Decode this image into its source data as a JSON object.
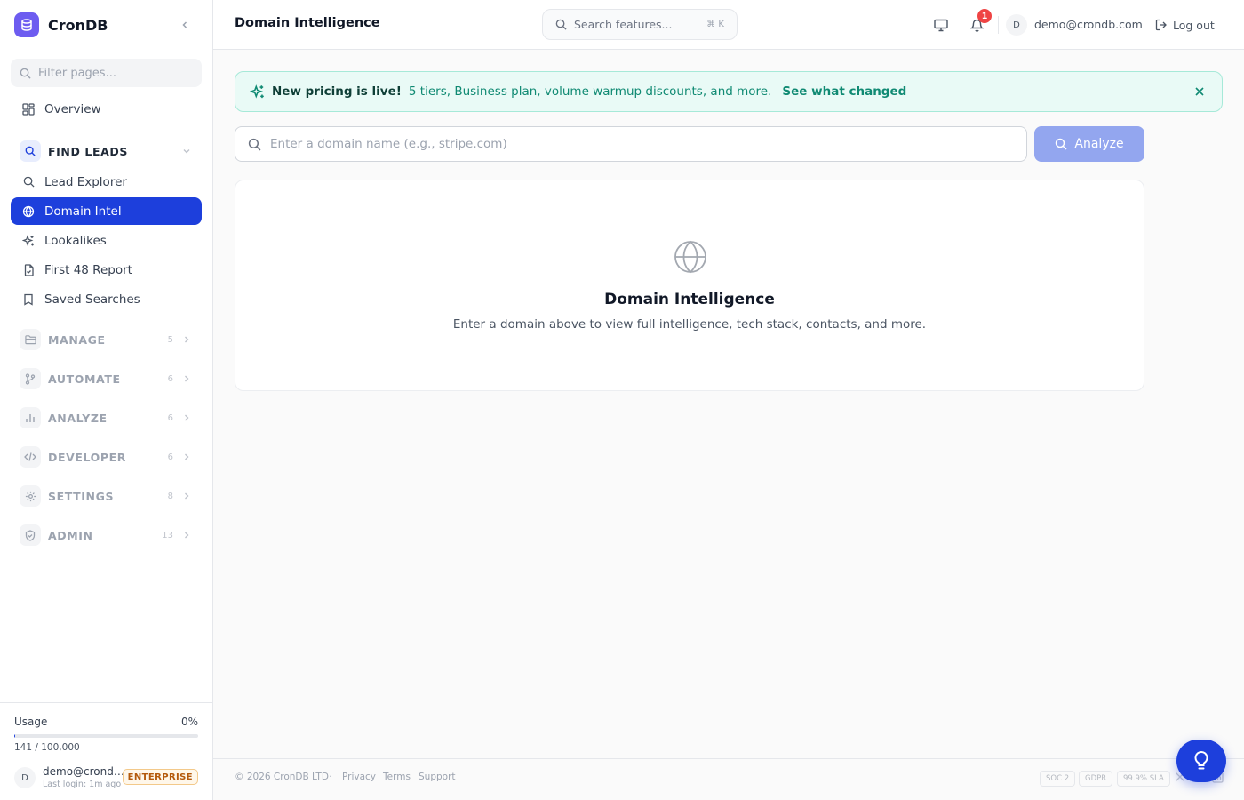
{
  "app": {
    "name": "CronDB"
  },
  "sidebar": {
    "filter_placeholder": "Filter pages...",
    "overview_label": "Overview",
    "find_leads": {
      "label": "FIND LEADS",
      "items": [
        {
          "label": "Lead Explorer",
          "icon": "search-icon"
        },
        {
          "label": "Domain Intel",
          "icon": "globe-icon",
          "active": true
        },
        {
          "label": "Lookalikes",
          "icon": "sparkle-icon"
        },
        {
          "label": "First 48 Report",
          "icon": "file-icon"
        },
        {
          "label": "Saved Searches",
          "icon": "bookmark-icon"
        }
      ]
    },
    "sections": [
      {
        "label": "MANAGE",
        "count": "5",
        "icon": "folder-icon"
      },
      {
        "label": "AUTOMATE",
        "count": "6",
        "icon": "branch-icon"
      },
      {
        "label": "ANALYZE",
        "count": "6",
        "icon": "bar-chart-icon"
      },
      {
        "label": "DEVELOPER",
        "count": "6",
        "icon": "code-icon"
      },
      {
        "label": "SETTINGS",
        "count": "8",
        "icon": "gear-icon"
      },
      {
        "label": "ADMIN",
        "count": "13",
        "icon": "shield-icon"
      }
    ],
    "usage": {
      "label": "Usage",
      "percent_text": "0%",
      "fraction": 0.0014,
      "count_text": "141 / 100,000"
    },
    "user": {
      "initial": "D",
      "email": "demo@crondb.com",
      "last_login": "Last login: 1m ago",
      "plan": "ENTERPRISE"
    }
  },
  "header": {
    "title": "Domain Intelligence",
    "search_placeholder": "Search features...",
    "search_shortcut": "⌘ K",
    "notification_count": "1",
    "user_initial": "D",
    "user_email": "demo@crondb.com",
    "logout_label": "Log out"
  },
  "banner": {
    "title": "New pricing is live!",
    "text": "5 tiers, Business plan, volume warmup discounts, and more.",
    "link": "See what changed"
  },
  "domain_search": {
    "placeholder": "Enter a domain name (e.g., stripe.com)",
    "value": "",
    "button_label": "Analyze"
  },
  "empty_state": {
    "title": "Domain Intelligence",
    "subtitle": "Enter a domain above to view full intelligence, tech stack, contacts, and more."
  },
  "footer": {
    "copyright": "© 2026 CronDB LTD",
    "separator": "·",
    "links": [
      "Privacy",
      "Terms",
      "Support"
    ],
    "badges": [
      "SOC 2",
      "GDPR",
      "99.9% SLA"
    ]
  },
  "colors": {
    "accent": "#1d3fdc",
    "brand": "#6d5cf0",
    "banner_bg": "#e9faf6",
    "banner_text": "#108a73",
    "notification": "#ef4444",
    "analyze_disabled": "#93a6ef"
  }
}
